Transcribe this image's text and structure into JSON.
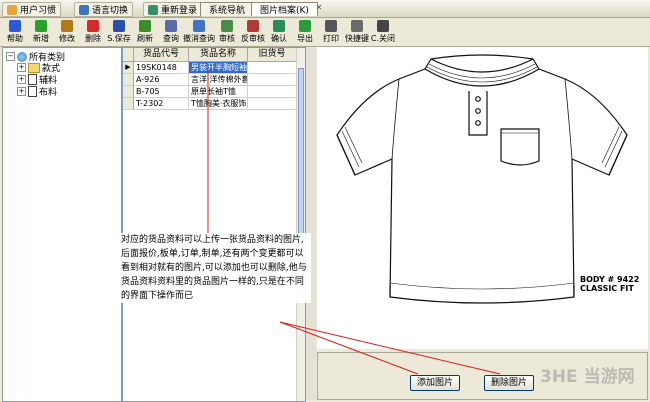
{
  "top_tabs": {
    "user_habit": "用户习惯",
    "language_switch": "语言切换",
    "relogin": "重新登录",
    "system_nav": "系统导航",
    "picture_archive": "图片档案(K)"
  },
  "toolbar": [
    {
      "label": "帮助",
      "icon": "help-icon",
      "color": "#2b5bd7"
    },
    {
      "label": "新增",
      "icon": "add-icon",
      "color": "#2aa12a"
    },
    {
      "label": "修改",
      "icon": "edit-icon",
      "color": "#b07a1a"
    },
    {
      "label": "删除",
      "icon": "delete-icon",
      "color": "#d42a2a"
    },
    {
      "label": "S.保存",
      "icon": "save-icon",
      "color": "#2b4fa8"
    },
    {
      "label": "刷新",
      "icon": "refresh-icon",
      "color": "#3a8e2a"
    },
    {
      "label": "查询",
      "icon": "search-icon",
      "color": "#5a6aa8"
    },
    {
      "label": "撤消查询",
      "icon": "undo-search-icon",
      "color": "#3f73c8"
    },
    {
      "label": "审核",
      "icon": "approve-icon",
      "color": "#4a8a4a"
    },
    {
      "label": "反审核",
      "icon": "unapprove-icon",
      "color": "#b03a3a"
    },
    {
      "label": "确认",
      "icon": "confirm-icon",
      "color": "#2a8a5a"
    },
    {
      "label": "导出",
      "icon": "export-icon",
      "color": "#2a9a3a"
    },
    {
      "label": "打印",
      "icon": "print-icon",
      "color": "#555555"
    },
    {
      "label": "快捷键",
      "icon": "shortcut-icon",
      "color": "#6a6a6a"
    },
    {
      "label": "C.关闭",
      "icon": "close-icon",
      "color": "#444444"
    }
  ],
  "tree": {
    "root": "所有类别",
    "children": [
      "款式",
      "辅料",
      "布料"
    ]
  },
  "grid": {
    "columns": [
      "货品代号",
      "货品名称",
      "旧货号"
    ],
    "rows": [
      [
        "19SK0148",
        "男装开半胸短袖",
        ""
      ],
      [
        "A-926",
        "言洋·洋传棉外套",
        ""
      ],
      [
        "B-705",
        "原单长袖T恤",
        ""
      ],
      [
        "T-2302",
        "T恤胸美·衣服饰",
        ""
      ]
    ]
  },
  "picture": {
    "body_label": "BODY # 9422",
    "fit_label": "CLASSIC FIT"
  },
  "buttons": {
    "add_picture": "添加图片",
    "delete_picture": "删除图片"
  },
  "annotation": {
    "text": "对应的货品资料可以上传一张货品资料的图片,后面报价,板单,订单,制单,还有两个变更都可以看到相对就有的图片,可以添加也可以删除,他与货品资料资料里的货品图片一样的,只是在不同的界面下操作而已"
  },
  "watermark": "当游网",
  "watermark_prefix": "3HE"
}
